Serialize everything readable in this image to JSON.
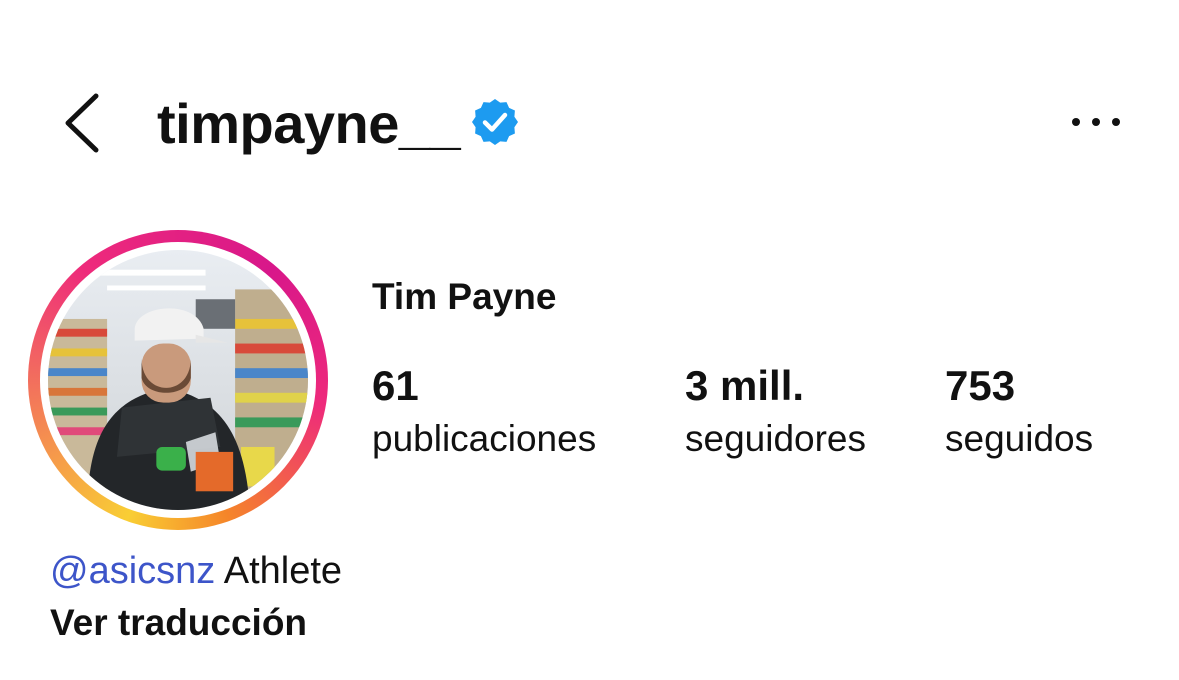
{
  "header": {
    "username": "timpayne__",
    "verified": true,
    "icons": {
      "back": "chevron-left-icon",
      "verified": "verified-badge-icon",
      "more": "more-horizontal-icon"
    },
    "accent_color": "#1d9bf0"
  },
  "profile": {
    "display_name": "Tim Payne",
    "stats": [
      {
        "value": "61",
        "label": "publicaciones"
      },
      {
        "value": "3 mill.",
        "label": "seguidores"
      },
      {
        "value": "753",
        "label": "seguidos"
      }
    ],
    "bio": {
      "mention": "@asicsnz",
      "text": "Athlete",
      "mention_color": "#3d55c9"
    },
    "translate_label": "Ver traducción"
  }
}
